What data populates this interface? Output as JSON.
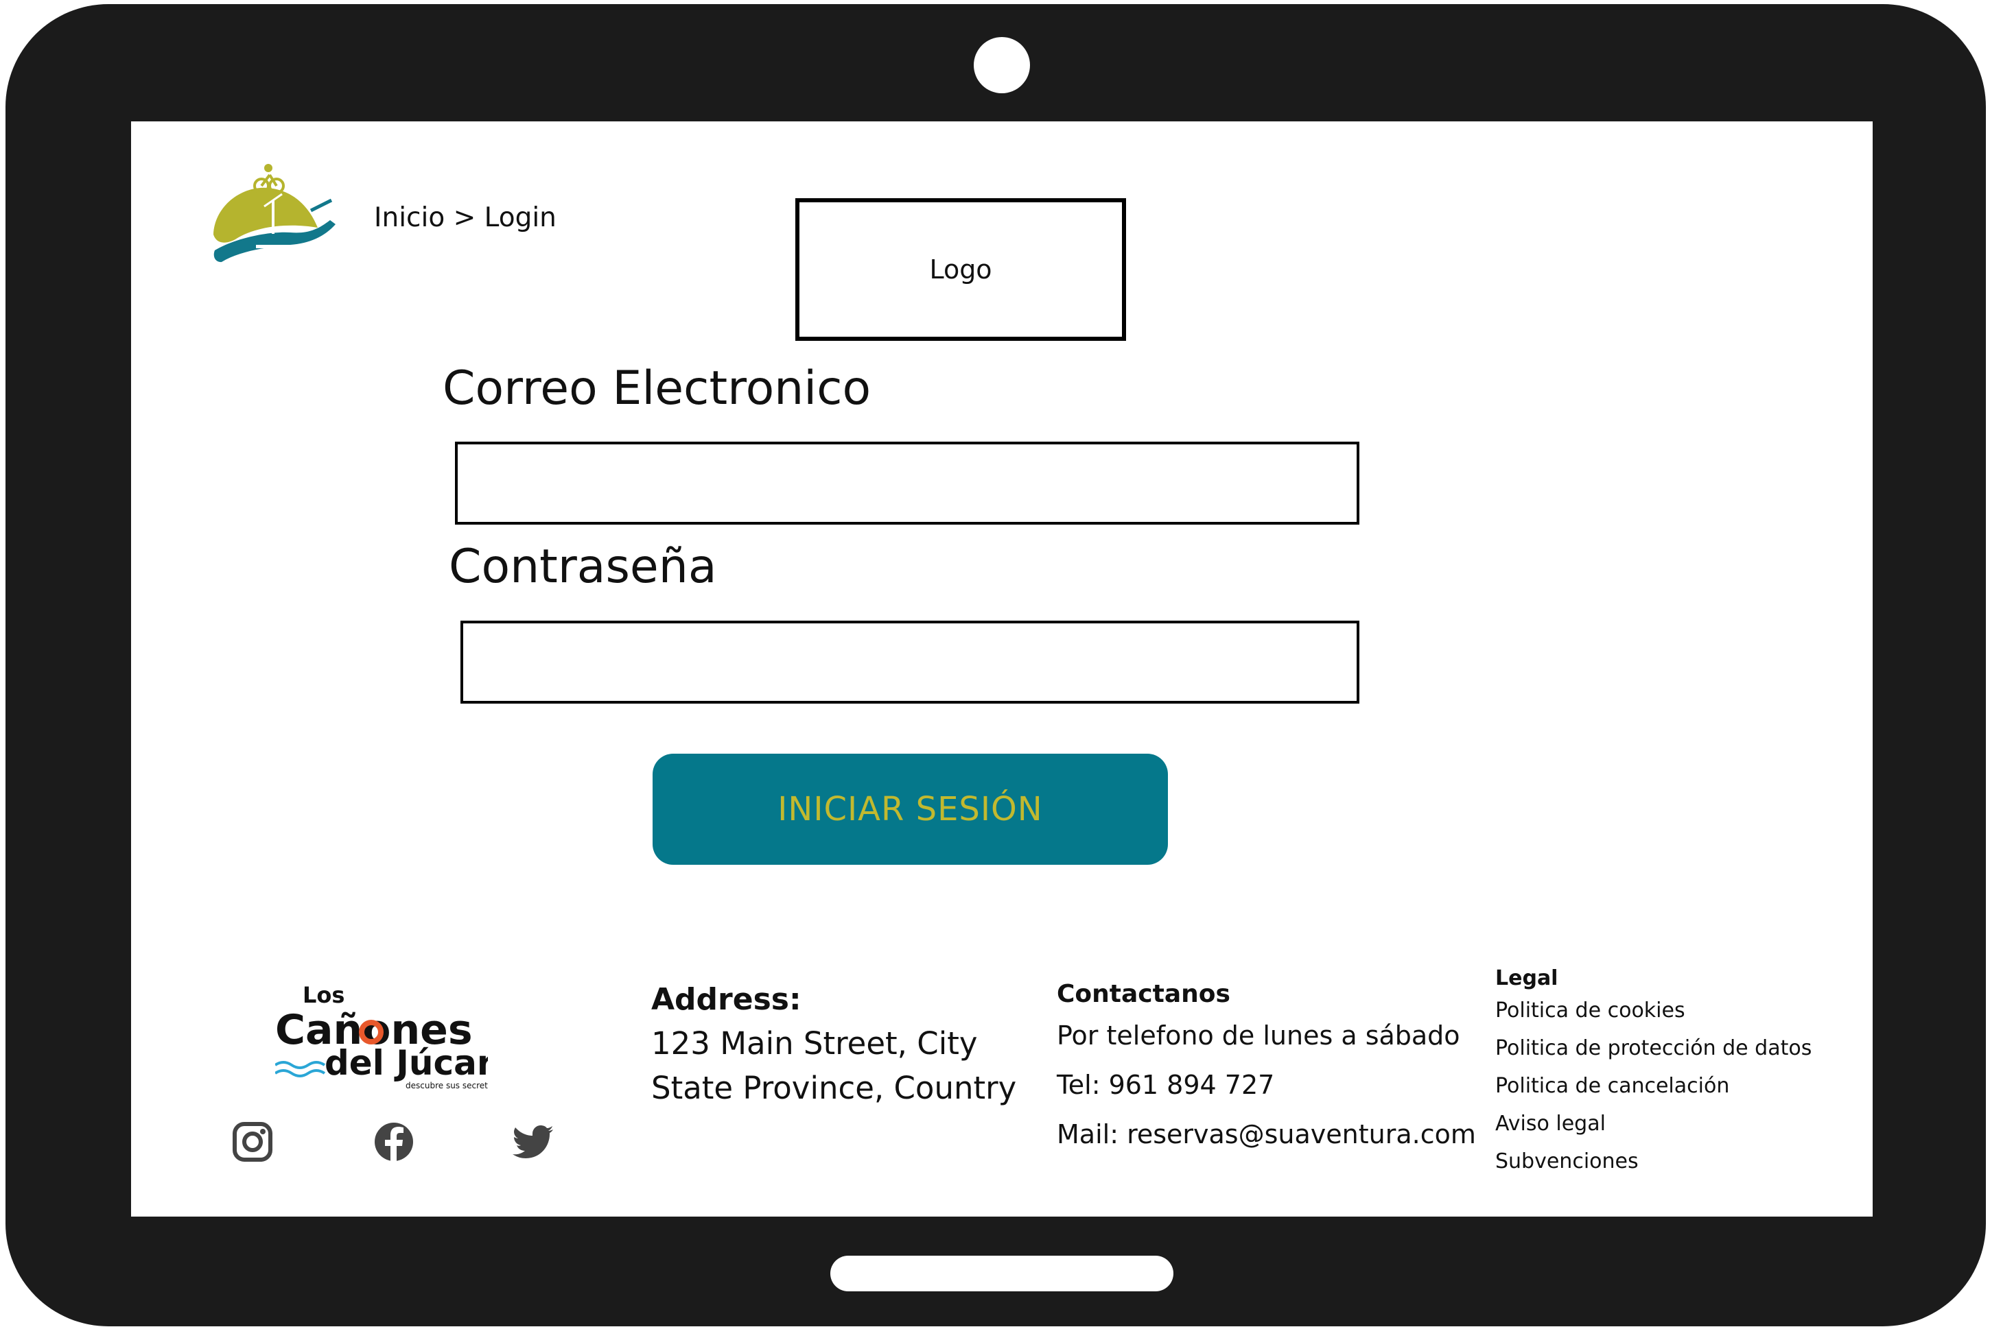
{
  "header": {
    "breadcrumb": "Inicio > Login",
    "logo_placeholder": "Logo"
  },
  "form": {
    "email_label": "Correo Electronico",
    "email_value": "",
    "password_label": "Contraseña",
    "password_value": "",
    "submit_label": "INICIAR SESIÓN"
  },
  "footer": {
    "brand": {
      "line1": "Los",
      "line2": "Cañones",
      "line3": "del Júcar",
      "tagline": "descubre sus secretos"
    },
    "social": [
      "instagram-icon",
      "facebook-icon",
      "twitter-icon"
    ],
    "address": {
      "title": "Address:",
      "line1": "123 Main Street, City",
      "line2": "State Province, Country"
    },
    "contact": {
      "title": "Contactanos",
      "hours": "Por telefono de lunes a sábado",
      "phone": "Tel: 961 894 727",
      "mail": "Mail: reservas@suaventura.com"
    },
    "legal": {
      "title": "Legal",
      "links": [
        "Politica de cookies",
        "Politica de protección de datos",
        "Politica de cancelación",
        "Aviso legal",
        "Subvenciones"
      ]
    }
  },
  "colors": {
    "device_frame": "#1b1b1b",
    "button_bg": "#05788b",
    "button_text": "#c2b92f",
    "brand_olive": "#b5b42e",
    "brand_teal": "#12788b",
    "brand_blue": "#2aa6d6",
    "brand_orange": "#e8582b"
  }
}
